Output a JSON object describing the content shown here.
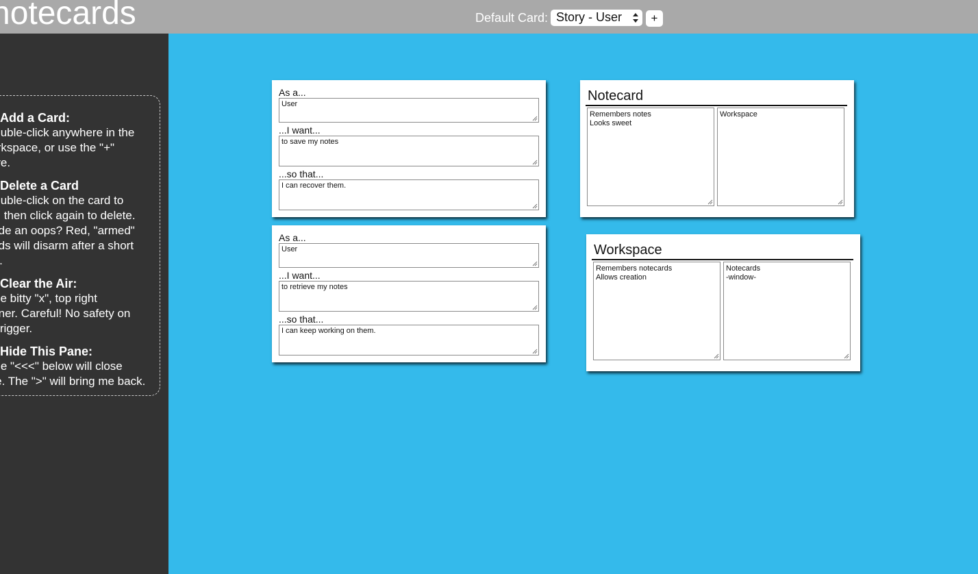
{
  "header": {
    "app_title": "notecards",
    "default_card_label": "Default Card:",
    "default_card_value": "Story - User",
    "add_button_label": "+"
  },
  "sidebar": {
    "sections": [
      {
        "heading": "Add a Card:",
        "lines": [
          "Double-click anywhere in the",
          "workspace, or use the \"+\"",
          "above."
        ]
      },
      {
        "heading": "Delete a Card",
        "lines": [
          "Double-click on the card to",
          "arm, then click again to delete.",
          "Made an oops? Red, \"armed\"",
          "cards will disarm after a short",
          "time."
        ]
      },
      {
        "heading": "Clear the Air:",
        "lines": [
          "Little bitty \"x\", top right",
          "corner. Careful! No safety on",
          "this trigger."
        ]
      },
      {
        "heading": "Hide This Pane:",
        "lines": [
          "The \"<<<\" below will close",
          "me. The \">\" will bring me back."
        ]
      }
    ]
  },
  "story_cards": [
    {
      "as_label": "As a...",
      "as_value": "User",
      "want_label": "...I want...",
      "want_value": "to save my notes",
      "so_label": "...so that...",
      "so_value": "I can recover them."
    },
    {
      "as_label": "As a...",
      "as_value": "User",
      "want_label": "...I want...",
      "want_value": "to retrieve my notes",
      "so_label": "...so that...",
      "so_value": "I can keep working on  them."
    }
  ],
  "crc_cards": [
    {
      "title": "Notecard",
      "responsibilities": [
        "Remembers notes",
        "Looks sweet"
      ],
      "collaborators": [
        "Workspace"
      ]
    },
    {
      "title": "Workspace",
      "responsibilities": [
        "Remembers notecards",
        "Allows creation"
      ],
      "collaborators": [
        "Notecards",
        "-window-"
      ]
    }
  ],
  "colors": {
    "workspace_bg": "#34baeb",
    "sidebar_bg": "#333333",
    "topbar_bg": "#a9a9a9"
  }
}
